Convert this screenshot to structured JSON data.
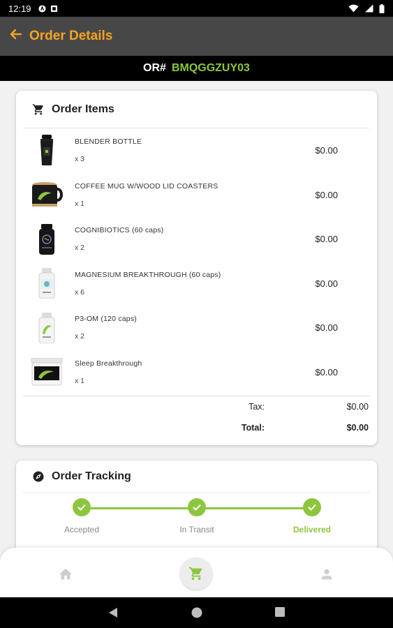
{
  "status_bar": {
    "time": "12:19"
  },
  "app_bar": {
    "title": "Order Details"
  },
  "order": {
    "prefix": "OR#",
    "code": "BMQGGZUY03"
  },
  "items_card": {
    "title": "Order Items",
    "items": [
      {
        "name": "BLENDER BOTTLE",
        "qty": "x 3",
        "price": "$0.00",
        "thumb": "bottle-thumb"
      },
      {
        "name": "COFFEE MUG W/WOOD LID COASTERS",
        "qty": "x 1",
        "price": "$0.00",
        "thumb": "mug-thumb"
      },
      {
        "name": "COGNIBIOTICS (60 caps)",
        "qty": "x 2",
        "price": "$0.00",
        "thumb": "black-jar-thumb"
      },
      {
        "name": "MAGNESIUM BREAKTHROUGH (60 caps)",
        "qty": "x 6",
        "price": "$0.00",
        "thumb": "white-bottle-thumb"
      },
      {
        "name": "P3-OM (120 caps)",
        "qty": "x 2",
        "price": "$0.00",
        "thumb": "white-bottle-green-thumb"
      },
      {
        "name": "Sleep Breakthrough",
        "qty": "x 1",
        "price": "$0.00",
        "thumb": "tub-thumb"
      }
    ],
    "tax_label": "Tax:",
    "tax_value": "$0.00",
    "total_label": "Total:",
    "total_value": "$0.00"
  },
  "tracking_card": {
    "title": "Order Tracking",
    "steps": [
      {
        "label": "Accepted",
        "done": false
      },
      {
        "label": "In Transit",
        "done": false
      },
      {
        "label": "Delivered",
        "done": true
      }
    ]
  },
  "colors": {
    "accent_orange": "#f5a422",
    "accent_green": "#8cc63f",
    "app_bar": "#474747"
  }
}
